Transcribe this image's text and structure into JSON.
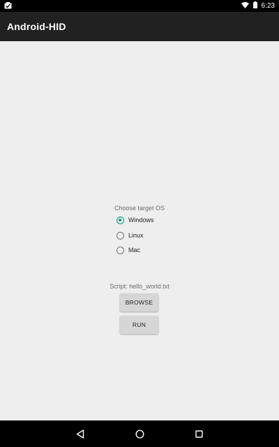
{
  "status_bar": {
    "time": "6:23",
    "icons": [
      "notification-icon",
      "wifi-icon",
      "battery-icon"
    ]
  },
  "app_bar": {
    "title": "Android-HID"
  },
  "main": {
    "os_prompt": "Choose target OS",
    "os_options": [
      {
        "label": "Windows",
        "checked": true
      },
      {
        "label": "Linux",
        "checked": false
      },
      {
        "label": "Mac",
        "checked": false
      }
    ],
    "script_label": "Script: hello_world.txt",
    "browse_button": "BROWSE",
    "run_button": "RUN"
  },
  "nav_bar": {
    "icons": [
      "back-icon",
      "home-icon",
      "recents-icon"
    ]
  },
  "colors": {
    "accent": "#009688",
    "app_bar": "#212121",
    "background": "#eeeeee"
  }
}
